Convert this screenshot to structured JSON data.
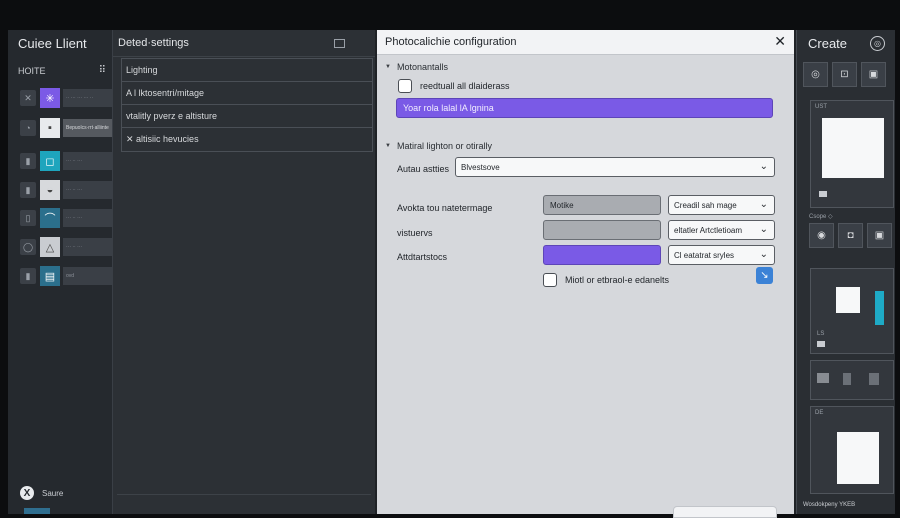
{
  "app": {
    "title": "Cuiee Llient",
    "home_label": "HOITE",
    "footer_label": "Saure",
    "footer_logo": "X"
  },
  "sidebar": {
    "items": [
      {
        "lead_icon": "✕",
        "thumb_icon": "✳",
        "thumb_color": "#7b5ae6",
        "label": "·· ··· ··· ··· ··"
      },
      {
        "lead_icon": "◔",
        "thumb_icon": "▪",
        "thumb_color": "#e8eaed",
        "label": "Bepuolcs·rrt·alliinte"
      },
      {
        "lead_icon": "▮",
        "thumb_icon": "◻",
        "thumb_color": "#1ea5bd",
        "label": "··· ·· ···"
      },
      {
        "lead_icon": "▮",
        "thumb_icon": "◒",
        "thumb_color": "#d7d9dc",
        "label": "··· ·· ···"
      },
      {
        "lead_icon": "▯",
        "thumb_icon": "⌒",
        "thumb_color": "#2b6f8c",
        "label": "··· ·· ···"
      },
      {
        "lead_icon": "◯",
        "thumb_icon": "△",
        "thumb_color": "#c9ccd1",
        "label": "··· ·· ···"
      },
      {
        "lead_icon": "▮",
        "thumb_icon": "▤",
        "thumb_color": "#2b6f8c",
        "label": "ovd"
      }
    ]
  },
  "settings": {
    "title": "Deted·settings",
    "rows": [
      "Lighting",
      "A l lktosentri/mitage",
      "vtalitly pverz e altisture",
      "✕ altisiic hevucies"
    ]
  },
  "dialog": {
    "title": "Photocalichie configuration",
    "close_label": "✕",
    "section1_title": "Motonantalls",
    "checkbox1_label": "reedtuall all dlaiderass",
    "purple_bar_text": "Yoar rola lalal lA lgnina",
    "section2_title": "Matiral lighton or otirally",
    "field1_label": "Autau astties",
    "field1_value": "Blvestsove",
    "rows": [
      {
        "label": "Avokta tou natetermage",
        "input": "Motike",
        "select": "Creadil sah mage"
      },
      {
        "label": "vistuervs",
        "input": "",
        "select": "eltatler Artctletioam"
      },
      {
        "label": "Attdtartstocs",
        "input": "",
        "select": "Cl eatatrat sryles"
      }
    ],
    "checkbox2_label": "Miotl or etbraol-e edanelts",
    "action_icon": "↘"
  },
  "right_panel": {
    "title": "Create",
    "settings_icon": "◎",
    "tiny_label_1": "UST",
    "tiny_label_2": "Csope ◇",
    "tiny_label_3": "LS",
    "tiny_label_4": "DE",
    "footer": "Wosdokpeny YKEB"
  }
}
